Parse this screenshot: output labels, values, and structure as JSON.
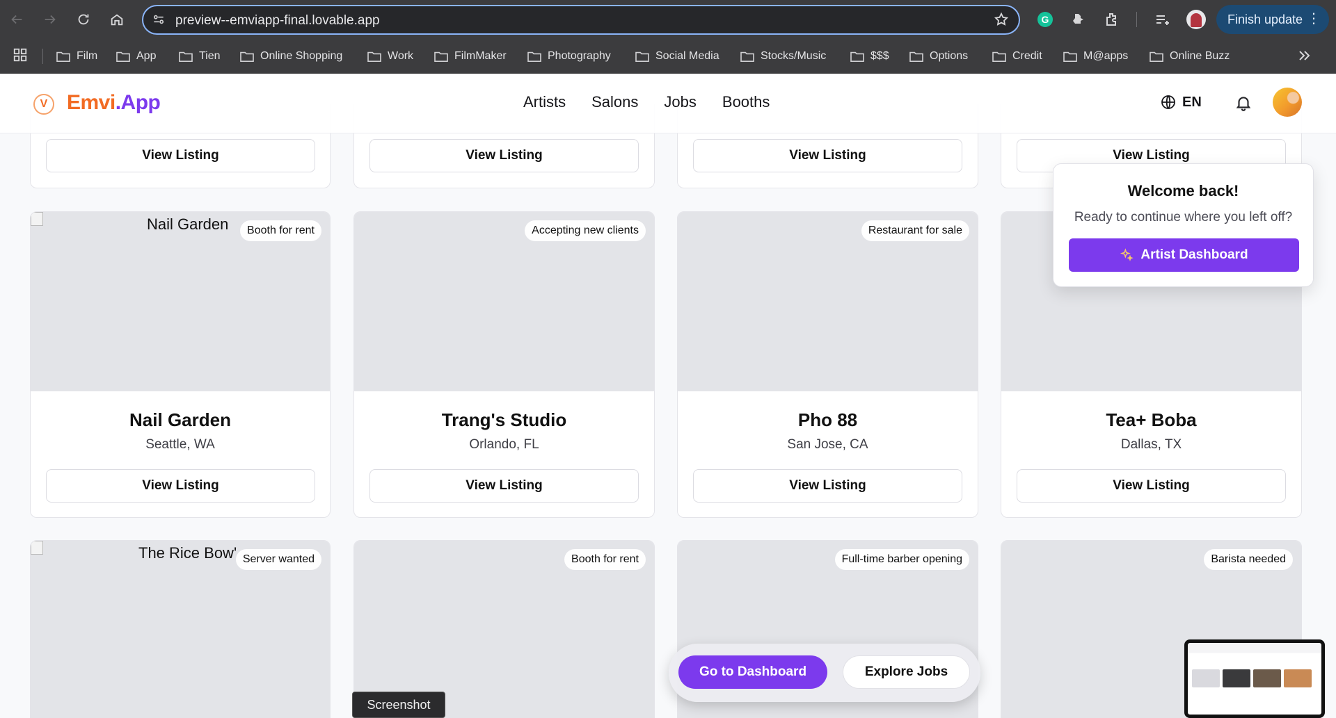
{
  "browser": {
    "url": "preview--emviapp-final.lovable.app",
    "finish_update": "Finish update",
    "bookmarks": [
      "Film",
      "App",
      "Tien",
      "Online Shopping",
      "Work",
      "FilmMaker",
      "Photography",
      "Social Media",
      "Stocks/Music",
      "$$$",
      "Options",
      "Credit",
      "M@apps",
      "Online Buzz"
    ]
  },
  "app": {
    "logo_mark": "V",
    "logo_part1": "Emvi",
    "logo_part2": ".App",
    "nav": [
      "Artists",
      "Salons",
      "Jobs",
      "Booths"
    ],
    "language": "EN"
  },
  "top_row": {
    "buttons": [
      "View Listing",
      "View Listing",
      "View Listing",
      "View Listing"
    ]
  },
  "cards": [
    {
      "name": "Nail Garden",
      "location": "Seattle, WA",
      "badge": "Booth for rent",
      "alt": "Nail Garden",
      "button": "View Listing"
    },
    {
      "name": "Trang's Studio",
      "location": "Orlando, FL",
      "badge": "Accepting new clients",
      "button": "View Listing"
    },
    {
      "name": "Pho 88",
      "location": "San Jose, CA",
      "badge": "Restaurant for sale",
      "button": "View Listing"
    },
    {
      "name": "Tea+ Boba",
      "location": "Dallas, TX",
      "badge": "",
      "button": "View Listing"
    }
  ],
  "bottom_row": [
    {
      "badge": "Server wanted",
      "alt": "The Rice Bow'"
    },
    {
      "badge": "Booth for rent"
    },
    {
      "badge": "Full-time barber opening"
    },
    {
      "badge": "Barista needed"
    }
  ],
  "welcome": {
    "title": "Welcome back!",
    "subtitle": "Ready to continue where you left off?",
    "button": "Artist Dashboard"
  },
  "floating_bar": {
    "primary": "Go to Dashboard",
    "secondary": "Explore Jobs"
  },
  "overlay": {
    "screenshot_tooltip": "Screenshot"
  },
  "colors": {
    "brand_orange": "#f26b23",
    "brand_purple": "#7c3aed",
    "chrome_dark": "#3c3c3e",
    "omnibox_focus": "#8ab4f8"
  }
}
